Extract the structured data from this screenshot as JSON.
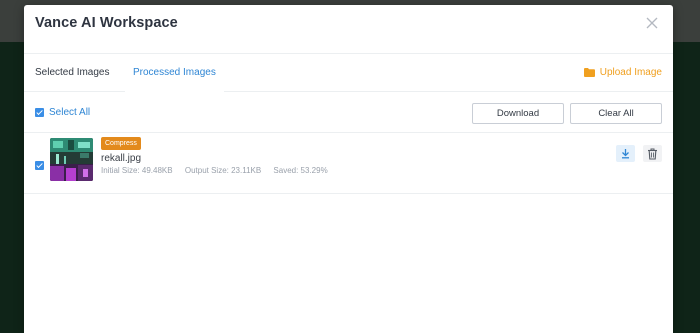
{
  "modal": {
    "title": "Vance AI Workspace"
  },
  "tabs": [
    {
      "label": "Selected Images",
      "active": false
    },
    {
      "label": "Processed Images",
      "active": true
    }
  ],
  "upload": {
    "label": "Upload Image",
    "icon": "folder-icon"
  },
  "toolbar": {
    "select_all_label": "Select All",
    "select_all_checked": true,
    "download_label": "Download",
    "clear_all_label": "Clear All"
  },
  "files": [
    {
      "badge": "Compress",
      "name": "rekall.jpg",
      "initial_size": "Initial Size: 49.48KB",
      "output_size": "Output Size: 23.11KB",
      "saved": "Saved: 53.29%",
      "checked": true
    }
  ],
  "colors": {
    "accent_blue": "#2f86d4",
    "upload_orange": "#f0a020",
    "badge_orange": "#e38a1c"
  }
}
